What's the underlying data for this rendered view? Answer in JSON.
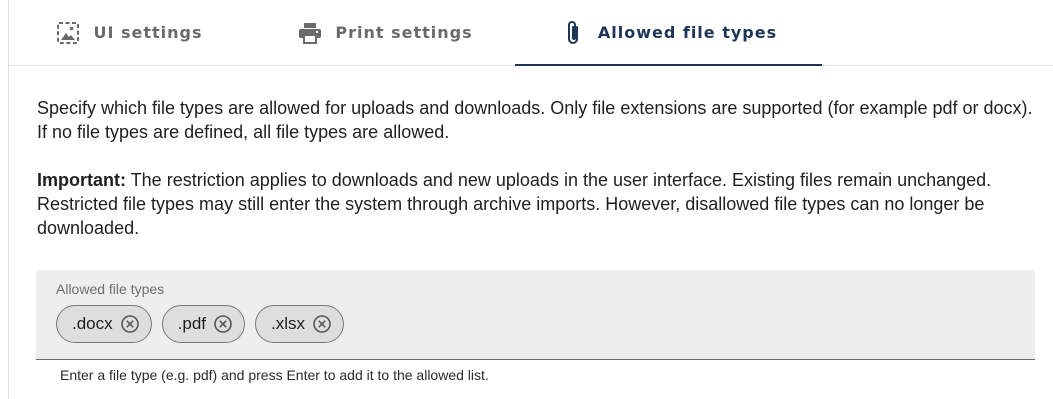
{
  "tabs": [
    {
      "label": "UI settings",
      "icon": "ui-settings-icon",
      "active": false
    },
    {
      "label": "Print settings",
      "icon": "printer-icon",
      "active": false
    },
    {
      "label": "Allowed file types",
      "icon": "paperclip-icon",
      "active": true
    }
  ],
  "description": {
    "intro": "Specify which file types are allowed for uploads and downloads. Only file extensions are supported (for example pdf or docx). If no file types are defined, all file types are allowed.",
    "important_label": "Important:",
    "important_text": " The restriction applies to downloads and new uploads in the user interface. Existing files remain unchanged. Restricted file types may still enter the system through archive imports. However, disallowed file types can no longer be downloaded."
  },
  "field": {
    "label": "Allowed file types",
    "chips": [
      ".docx",
      ".pdf",
      ".xlsx"
    ],
    "chip_remove_icon": "close-circle-icon",
    "hint": "Enter a file type (e.g. pdf) and press Enter to add it to the allowed list."
  },
  "colors": {
    "accent": "#1f3555",
    "inactive_tab": "#6a6a6a",
    "field_bg": "#eeeeee",
    "chip_bg": "#dedede"
  }
}
